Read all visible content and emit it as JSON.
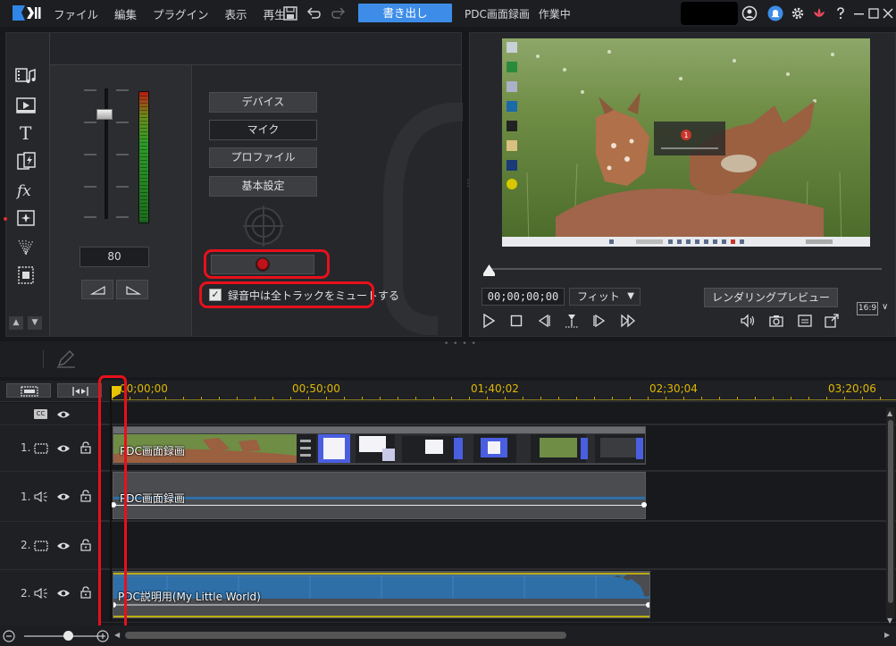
{
  "app": {
    "menu": [
      "ファイル",
      "編集",
      "プラグイン",
      "表示",
      "再生"
    ],
    "export_label": "書き出し",
    "project_title": "PDC画面録画",
    "project_status": "作業中"
  },
  "capture_panel": {
    "volume_value": "80",
    "buttons": {
      "device": "デバイス",
      "mic": "マイク",
      "profile": "プロファイル",
      "basic_settings": "基本設定"
    },
    "mute_all_tracks_label": "録音中は全トラックをミュートする",
    "mute_all_tracks_checked": true
  },
  "preview": {
    "timecode": "00;00;00;00",
    "fit_label": "フィット",
    "render_preview_label": "レンダリングプレビュー",
    "aspect_ratio": "16:9",
    "overlay_number": "1"
  },
  "timeline": {
    "ruler_labels": [
      "00;00;00",
      "00;50;00",
      "01;40;02",
      "02;30;04",
      "03;20;06"
    ],
    "tracks": [
      {
        "number": "1.",
        "kind": "video",
        "clip": "PDC画面録画"
      },
      {
        "number": "1.",
        "kind": "audio",
        "clip": "PDC画面録画"
      },
      {
        "number": "2.",
        "kind": "video",
        "clip": ""
      },
      {
        "number": "2.",
        "kind": "audio",
        "clip": "PDC説明用(My Little World)"
      }
    ],
    "cc_label": "CC"
  },
  "colors": {
    "accent": "#3d8de8",
    "highlight_red": "#e8101b",
    "ruler_yellow": "#e0b800",
    "audio_wave": "#2e6fa8"
  }
}
